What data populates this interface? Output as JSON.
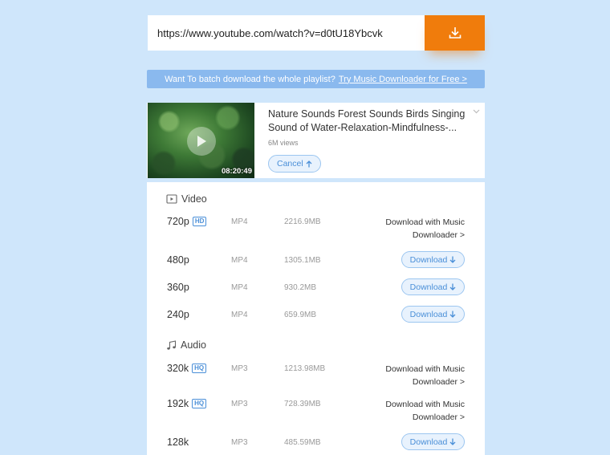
{
  "search": {
    "url": "https://www.youtube.com/watch?v=d0tU18Ybcvk"
  },
  "banner": {
    "text": "Want To batch download the whole playlist?",
    "link": "Try Music Downloader for Free >"
  },
  "video": {
    "title": "Nature Sounds Forest Sounds Birds Singing Sound of Water-Relaxation-Mindfulness-...",
    "views": "6M views",
    "duration": "08:20:49",
    "cancel_label": "Cancel"
  },
  "sections": {
    "video_label": "Video",
    "audio_label": "Audio"
  },
  "video_rows": [
    {
      "quality": "720p",
      "badge": "HD",
      "format": "MP4",
      "size": "2216.9MB",
      "action": "Download with Music Downloader >"
    },
    {
      "quality": "480p",
      "format": "MP4",
      "size": "1305.1MB",
      "action": "Download"
    },
    {
      "quality": "360p",
      "format": "MP4",
      "size": "930.2MB",
      "action": "Download"
    },
    {
      "quality": "240p",
      "format": "MP4",
      "size": "659.9MB",
      "action": "Download"
    }
  ],
  "audio_rows": [
    {
      "quality": "320k",
      "badge": "HQ",
      "format": "MP3",
      "size": "1213.98MB",
      "action": "Download with Music Downloader >"
    },
    {
      "quality": "192k",
      "badge": "HQ",
      "format": "MP3",
      "size": "728.39MB",
      "action": "Download with Music Downloader >"
    },
    {
      "quality": "128k",
      "format": "MP3",
      "size": "485.59MB",
      "action": "Download"
    }
  ],
  "colors": {
    "background": "#cfe6fb",
    "accent": "#f07c0c",
    "link_blue": "#4a8fd8",
    "banner": "#8ab9ee"
  },
  "icons": {
    "download_button": "download-icon",
    "video_section": "video-icon",
    "audio_section": "music-note-icon",
    "play": "play-icon"
  }
}
